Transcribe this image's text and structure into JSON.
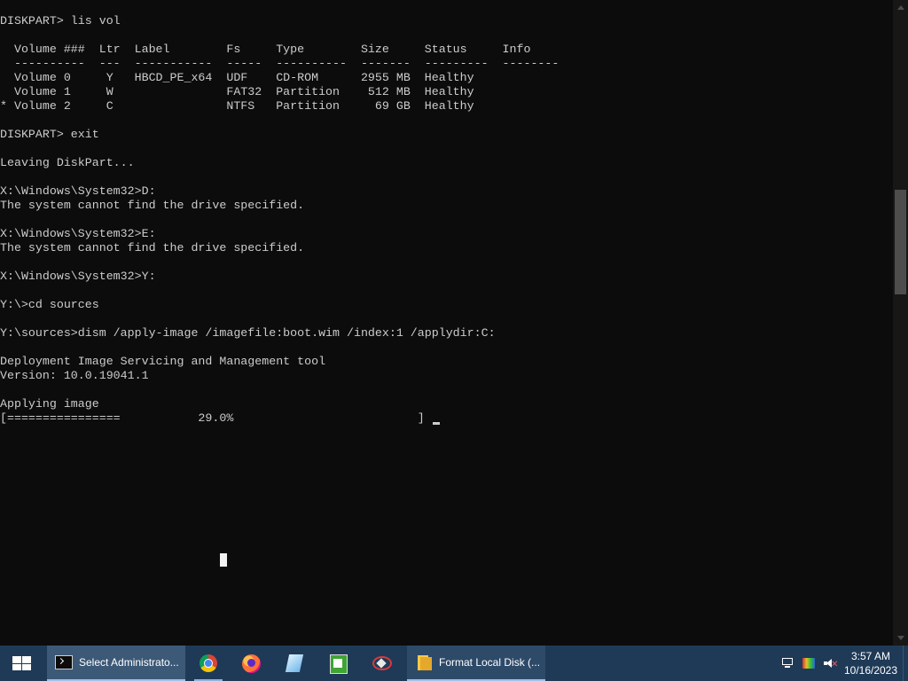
{
  "console": {
    "lines": [
      "DISKPART> lis vol",
      "",
      "  Volume ###  Ltr  Label        Fs     Type        Size     Status     Info",
      "  ----------  ---  -----------  -----  ----------  -------  ---------  --------",
      "  Volume 0     Y   HBCD_PE_x64  UDF    CD-ROM      2955 MB  Healthy",
      "  Volume 1     W                FAT32  Partition    512 MB  Healthy",
      "* Volume 2     C                NTFS   Partition     69 GB  Healthy",
      "",
      "DISKPART> exit",
      "",
      "Leaving DiskPart...",
      "",
      "X:\\Windows\\System32>D:",
      "The system cannot find the drive specified.",
      "",
      "X:\\Windows\\System32>E:",
      "The system cannot find the drive specified.",
      "",
      "X:\\Windows\\System32>Y:",
      "",
      "Y:\\>cd sources",
      "",
      "Y:\\sources>dism /apply-image /imagefile:boot.wim /index:1 /applydir:C:",
      "",
      "Deployment Image Servicing and Management tool",
      "Version: 10.0.19041.1",
      "",
      "Applying image",
      "[================           29.0%                          ]"
    ]
  },
  "progress": {
    "percent": 29.0
  },
  "taskbar": {
    "start_icon": "windows-logo-icon",
    "tasks": [
      {
        "label": "Select Administrato...",
        "icon": "command-prompt-icon"
      },
      {
        "label": "Format Local Disk (...",
        "icon": "folder-icon"
      }
    ],
    "pinned_icons": [
      "chrome-icon",
      "firefox-icon",
      "app-icon",
      "notepad-icon",
      "partition-tool-icon"
    ],
    "tray_icons": [
      "network-icon",
      "display-icon",
      "volume-muted-icon"
    ],
    "clock": {
      "time": "3:57 AM",
      "date": "10/16/2023"
    }
  },
  "colors": {
    "console_bg": "#0c0c0c",
    "console_text": "#cccccc",
    "taskbar_bg": "#1f3a57"
  }
}
